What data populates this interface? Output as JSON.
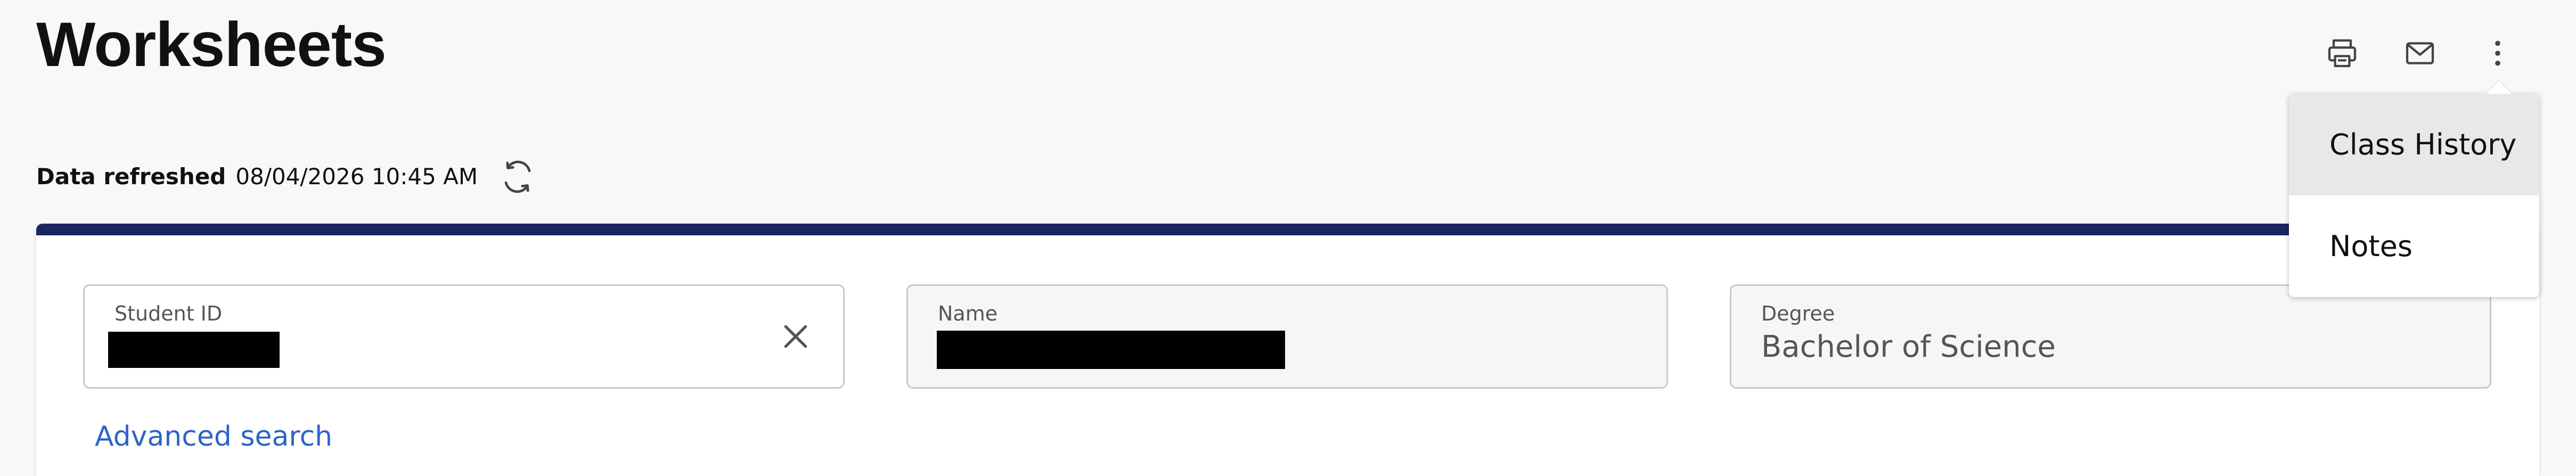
{
  "page": {
    "title": "Worksheets"
  },
  "toolbar": {
    "print_icon": "print-icon",
    "email_icon": "mail-icon",
    "more_icon": "more-vertical-icon"
  },
  "refresh": {
    "label": "Data refreshed",
    "value": "08/04/2026 10:45 AM",
    "icon": "refresh-icon"
  },
  "search_form": {
    "accent_color": "#1b2560",
    "student_id": {
      "label": "Student ID",
      "value_redacted": true,
      "clear_icon": "close-icon"
    },
    "name": {
      "label": "Name",
      "value_redacted": true
    },
    "degree": {
      "label": "Degree",
      "value": "Bachelor of Science"
    },
    "advanced_link": "Advanced search"
  },
  "menu": {
    "items": [
      {
        "label": "Class History"
      },
      {
        "label": "Notes"
      }
    ]
  },
  "colors": {
    "background": "#f8f8f8",
    "link": "#2d63c8",
    "header_bar": "#1b2560"
  }
}
